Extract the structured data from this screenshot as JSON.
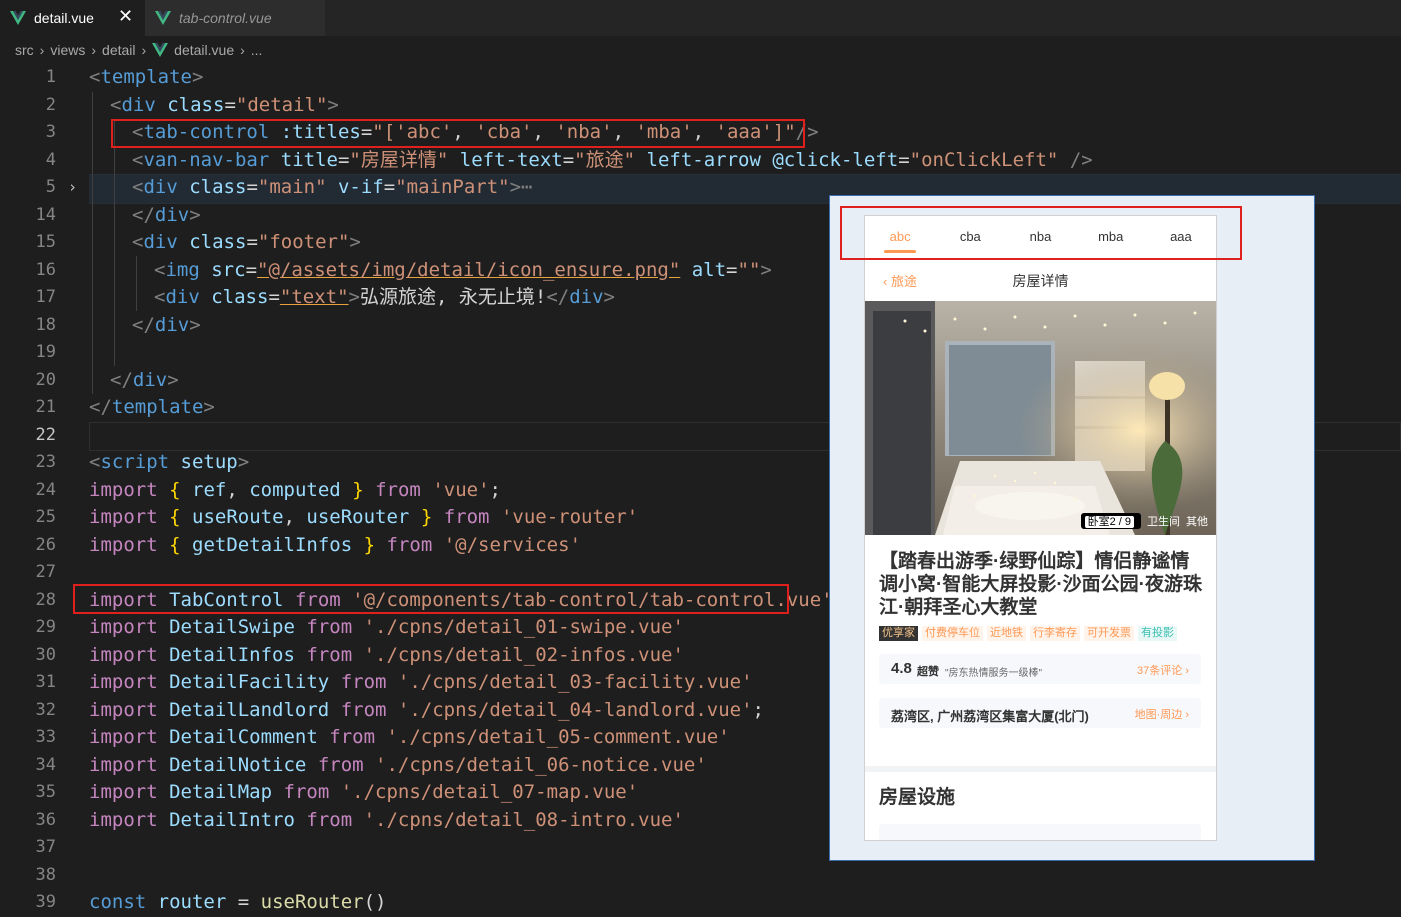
{
  "tabs": [
    {
      "label": "detail.vue",
      "active": true,
      "close": "✕"
    },
    {
      "label": "tab-control.vue",
      "active": false
    }
  ],
  "breadcrumb": [
    "src",
    "views",
    "detail",
    "detail.vue",
    "..."
  ],
  "editor": {
    "line_numbers": [
      "1",
      "2",
      "3",
      "4",
      "5",
      "14",
      "15",
      "16",
      "17",
      "18",
      "19",
      "20",
      "21",
      "22",
      "23",
      "24",
      "25",
      "26",
      "27",
      "28",
      "29",
      "30",
      "31",
      "32",
      "33",
      "34",
      "35",
      "36",
      "37",
      "38",
      "39"
    ],
    "current_line": "22",
    "folded_line": "5"
  },
  "code": {
    "l1_open": "<",
    "l1_tag": "template",
    "l1_close": ">",
    "l2_tag": "div",
    "l2_attr": "class",
    "l2_val": "\"detail\"",
    "l3_tag": "tab-control",
    "l3_attr": ":titles",
    "l3_q1": "\"[",
    "l3_s1": "'abc'",
    "l3_s2": "'cba'",
    "l3_s3": "'nba'",
    "l3_s4": "'mba'",
    "l3_s5": "'aaa'",
    "l3_q2": "]\"",
    "l4_tag": "van-nav-bar",
    "l4_a1": "title",
    "l4_v1": "\"房屋详情\"",
    "l4_a2": "left-text",
    "l4_v2": "\"旅途\"",
    "l4_a3": "left-arrow",
    "l4_a4": "@click-left",
    "l4_v4": "\"onClickLeft\"",
    "l5_tag": "div",
    "l5_a1": "class",
    "l5_v1": "\"main\"",
    "l5_a2": "v-if",
    "l5_v2": "\"mainPart\"",
    "l5_ellipsis": "⋯",
    "l14_tag": "div",
    "l15_tag": "div",
    "l15_attr": "class",
    "l15_val": "\"footer\"",
    "l16_tag": "img",
    "l16_a1": "src",
    "l16_v1": "\"@/assets/img/detail/icon_ensure.png\"",
    "l16_a2": "alt",
    "l16_v2": "\"\"",
    "l17_tag": "div",
    "l17_attr": "class",
    "l17_val": "\"text\"",
    "l17_text": "弘源旅途, 永无止境!",
    "l18_tag": "div",
    "l20_tag": "div",
    "l21_tag": "template",
    "l23_tag": "script",
    "l23_attr": "setup",
    "l24": {
      "kw": "import",
      "names": [
        "ref",
        "computed"
      ],
      "from": "from",
      "src": "'vue'",
      "end": ";"
    },
    "l25": {
      "kw": "import",
      "names": [
        "useRoute",
        "useRouter"
      ],
      "from": "from",
      "src": "'vue-router'"
    },
    "l26": {
      "kw": "import",
      "names": [
        "getDetailInfos"
      ],
      "from": "from",
      "src": "'@/services'"
    },
    "imports": [
      {
        "line": "28",
        "name": "TabControl",
        "src": "'@/components/tab-control/tab-control.vue'",
        "end": ""
      },
      {
        "line": "29",
        "name": "DetailSwipe",
        "src": "'./cpns/detail_01-swipe.vue'",
        "end": ""
      },
      {
        "line": "30",
        "name": "DetailInfos",
        "src": "'./cpns/detail_02-infos.vue'",
        "end": ""
      },
      {
        "line": "31",
        "name": "DetailFacility",
        "src": "'./cpns/detail_03-facility.vue'",
        "end": ""
      },
      {
        "line": "32",
        "name": "DetailLandlord",
        "src": "'./cpns/detail_04-landlord.vue'",
        "end": ";"
      },
      {
        "line": "33",
        "name": "DetailComment",
        "src": "'./cpns/detail_05-comment.vue'",
        "end": ""
      },
      {
        "line": "34",
        "name": "DetailNotice",
        "src": "'./cpns/detail_06-notice.vue'",
        "end": ""
      },
      {
        "line": "35",
        "name": "DetailMap",
        "src": "'./cpns/detail_07-map.vue'",
        "end": ""
      },
      {
        "line": "36",
        "name": "DetailIntro",
        "src": "'./cpns/detail_08-intro.vue'",
        "end": ""
      }
    ],
    "import_kw": "import",
    "from_kw": "from",
    "l39": {
      "kw": "const",
      "name": "router",
      "eq": "=",
      "fn": "useRouter",
      "paren": "()"
    }
  },
  "preview": {
    "tab_control": [
      "abc",
      "cba",
      "nba",
      "mba",
      "aaa"
    ],
    "active_tab": "abc",
    "nav_back": "旅途",
    "nav_title": "房屋详情",
    "photo_badge_count": "卧室2 / 9",
    "photo_badge_2": "卫生间",
    "photo_badge_3": "其他",
    "house_title": "【踏春出游季·绿野仙踪】情侣静谧情调小窝·智能大屏投影·沙面公园·夜游珠江·朝拜圣心大教堂",
    "tags": [
      "优享家",
      "付费停车位",
      "近地铁",
      "行李寄存",
      "可开发票",
      "有投影"
    ],
    "score": "4.8",
    "score_title": "超赞",
    "score_quote": "\"房东热情服务一级棒\"",
    "comments_link": "37条评论",
    "address": "荔湾区, 广州荔湾区集富大厦(北门)",
    "map_link": "地图·周边",
    "section_title": "房屋设施"
  },
  "colors": {
    "accent": "#ff9854",
    "highlight_box": "#e0201c",
    "editor_bg": "#1e1e1e"
  }
}
